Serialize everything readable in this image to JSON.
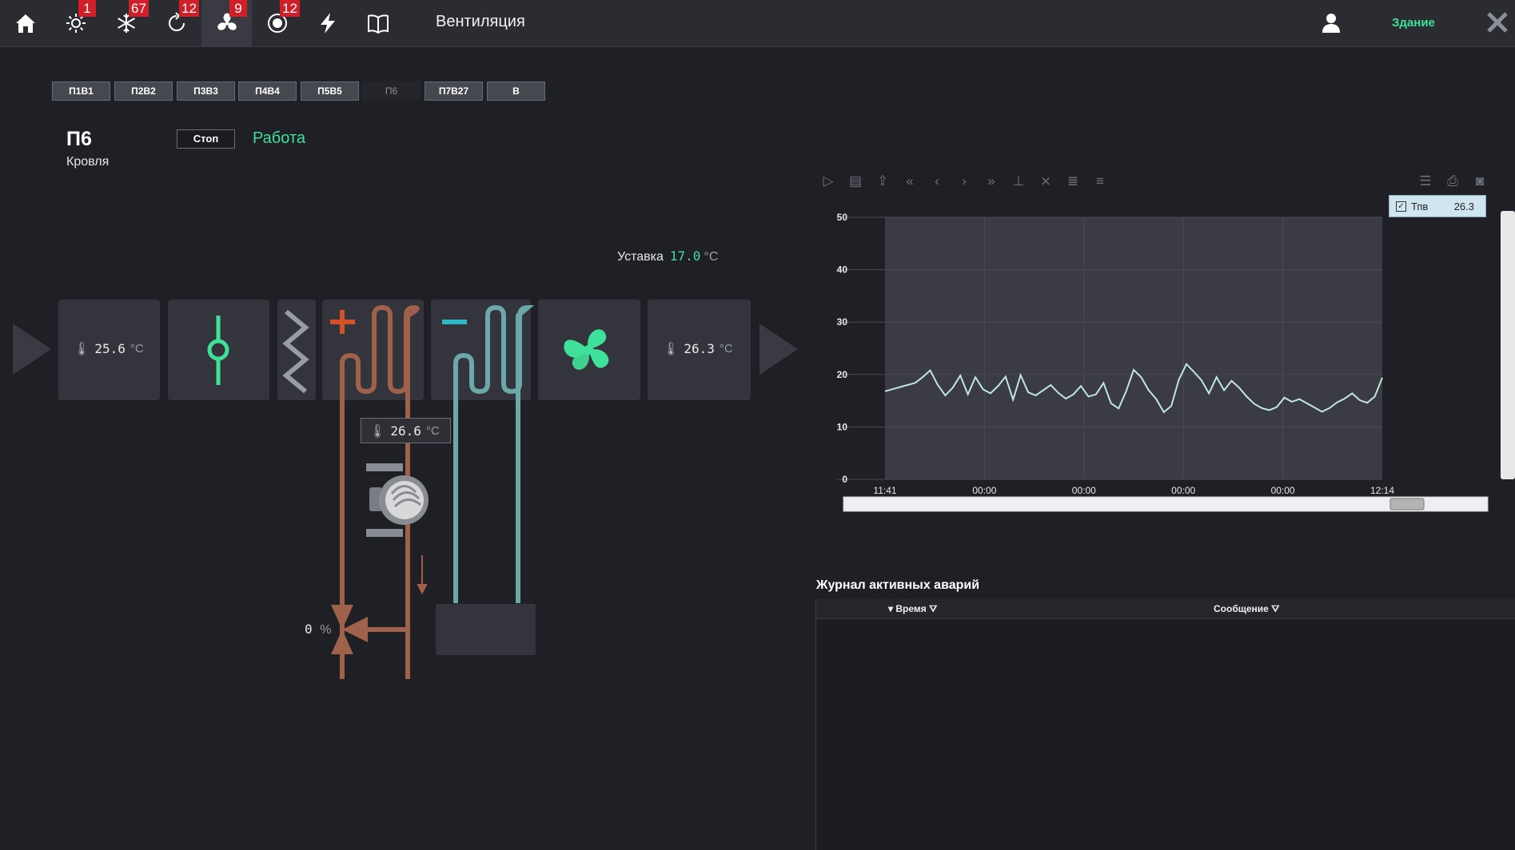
{
  "header": {
    "title": "Вентиляция",
    "nav": [
      {
        "icon": "home-icon",
        "badge": ""
      },
      {
        "icon": "sun-icon",
        "badge": "1"
      },
      {
        "icon": "snowflake-icon",
        "badge": "67"
      },
      {
        "icon": "refresh-icon",
        "badge": "12"
      },
      {
        "icon": "fan-icon",
        "badge": "9",
        "active": true
      },
      {
        "icon": "record-icon",
        "badge": "12"
      },
      {
        "icon": "lightning-icon",
        "badge": ""
      },
      {
        "icon": "book-icon",
        "badge": ""
      }
    ],
    "building_label": "Здание"
  },
  "unit_tabs": [
    "П1В1",
    "П2В2",
    "П3В3",
    "П4В4",
    "П5В5",
    "П6",
    "П7В27",
    "В"
  ],
  "current_tab": "П6",
  "unit": {
    "name": "П6",
    "location": "Кровля",
    "stop_label": "Стоп",
    "status": "Работа"
  },
  "setpoint": {
    "label": "Уставка",
    "value": "17.0",
    "unit": "°C"
  },
  "scheme": {
    "outdoor_temp": "25.6",
    "supply_temp": "26.3",
    "water_temp": "26.6",
    "valve_position": "0",
    "temp_unit": "°C",
    "percent_unit": "%"
  },
  "colors": {
    "accent_green": "#3fe09a",
    "heating_pipe": "#a0614a",
    "cooling_pipe": "#6aa9a8",
    "heating_plus": "#d2502a",
    "cooling_minus": "#2fb9c4",
    "badge": "#d11f2a"
  },
  "chart_data": {
    "type": "line",
    "legend": {
      "name": "Тпв",
      "value": "26.3",
      "placement": "top-right"
    },
    "ylim": [
      0,
      50
    ],
    "yticks": [
      "0",
      "10",
      "20",
      "30",
      "40",
      "50"
    ],
    "xticks": [
      "11:41",
      "00:00",
      "00:00",
      "00:00",
      "00:00",
      "12:14"
    ],
    "grid": true,
    "series": [
      {
        "name": "Тпв",
        "values": [
          16.8,
          17.2,
          17.6,
          18,
          18.4,
          19.5,
          20.8,
          18,
          16,
          17.5,
          19.8,
          16.2,
          19.5,
          17.2,
          16.4,
          17.8,
          19.6,
          15.2,
          19.9,
          16.6,
          16,
          17,
          18,
          16.5,
          15.4,
          16.2,
          17.8,
          15.8,
          16.2,
          18.4,
          14.5,
          13.5,
          16.8,
          20.9,
          19.5,
          17,
          15.3,
          12.8,
          14,
          19,
          22,
          20.5,
          18.9,
          16.4,
          19.5,
          17,
          18.8,
          17.5,
          15.8,
          14.4,
          13.6,
          13.2,
          13.8,
          15.6,
          14.8,
          15.3,
          14.5,
          13.7,
          12.9,
          13.6,
          14.7,
          15.4,
          16.4,
          15.1,
          14.6,
          15.8,
          19.4
        ]
      }
    ]
  },
  "alarm_log": {
    "title": "Журнал активных аварий",
    "columns": [
      "Время",
      "Сообщение"
    ],
    "rows": []
  }
}
